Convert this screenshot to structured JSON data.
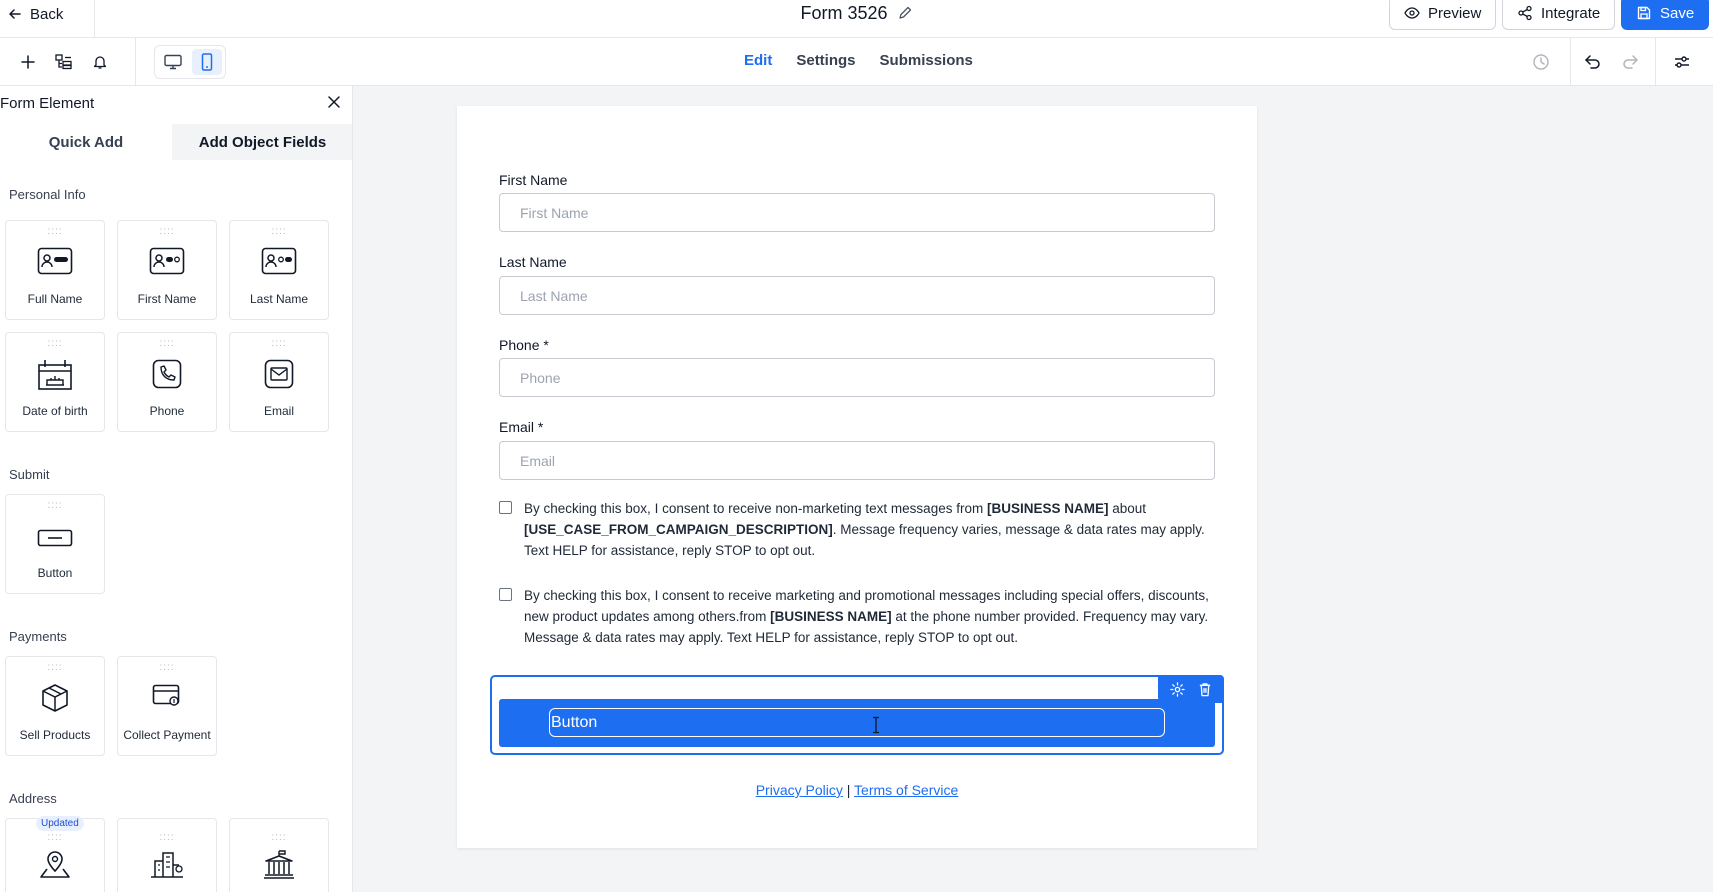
{
  "header": {
    "back_label": "Back",
    "form_title": "Form 3526",
    "preview_label": "Preview",
    "integrate_label": "Integrate",
    "save_label": "Save"
  },
  "nav": {
    "tabs": [
      "Edit",
      "Settings",
      "Submissions"
    ],
    "active": "Edit"
  },
  "panel": {
    "title": "Form Element",
    "tab_quick": "Quick Add",
    "tab_object": "Add Object Fields",
    "sections": {
      "personal": "Personal Info",
      "submit": "Submit",
      "payments": "Payments",
      "address": "Address"
    },
    "personal_items": [
      "Full Name",
      "First Name",
      "Last Name",
      "Date of birth",
      "Phone",
      "Email"
    ],
    "submit_items": [
      "Button"
    ],
    "payment_items": [
      "Sell Products",
      "Collect Payment"
    ],
    "address_badge": "Updated"
  },
  "form": {
    "fields": [
      {
        "label": "First Name",
        "placeholder": "First Name"
      },
      {
        "label": "Last Name",
        "placeholder": "Last Name"
      },
      {
        "label": "Phone *",
        "placeholder": "Phone"
      },
      {
        "label": "Email *",
        "placeholder": "Email"
      }
    ],
    "consent1": {
      "a": "By checking this box, I consent to receive non-marketing text messages from ",
      "b": "[BUSINESS NAME]",
      "c": " about ",
      "d": "[USE_CASE_FROM_CAMPAIGN_DESCRIPTION]",
      "e": ". Message frequency varies, message & data rates may apply. Text HELP for assistance, reply STOP to opt out."
    },
    "consent2": {
      "a": "By checking this box, I consent to receive marketing and promotional messages including special offers, discounts, new product updates among others.from ",
      "b": "[BUSINESS NAME]",
      "c": " at the phone number provided. Frequency may vary. Message & data rates may apply. Text HELP for assistance, reply STOP to opt out."
    },
    "button_text": "Button",
    "privacy": "Privacy Policy",
    "divider": "|",
    "terms": "Terms of Service"
  },
  "colors": {
    "accent": "#1d6ef0",
    "canvas_bg": "#f3f4f6"
  }
}
